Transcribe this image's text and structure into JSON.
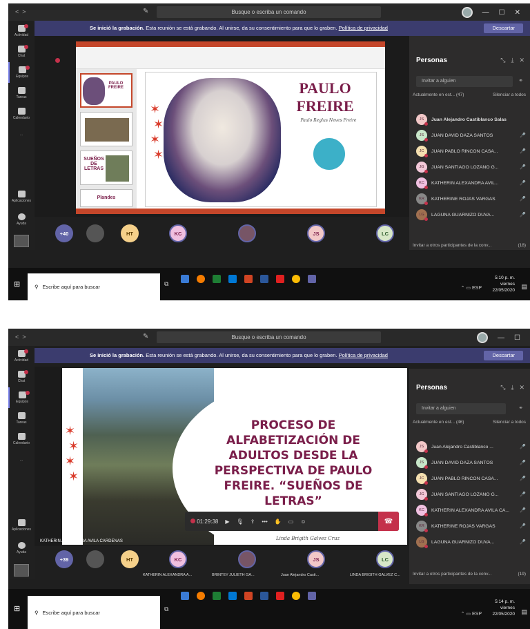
{
  "app": {
    "search_placeholder": "Busque o escriba un comando",
    "nav_back": "<",
    "nav_forward": ">",
    "window_minimize": "—",
    "window_maximize": "☐",
    "window_close": "✕"
  },
  "rail": {
    "items": [
      {
        "label": "Actividad",
        "badge": true
      },
      {
        "label": "Chat",
        "badge": true
      },
      {
        "label": "Equipos",
        "badge": true
      },
      {
        "label": "Tareas",
        "badge": false
      },
      {
        "label": "Calendario",
        "badge": false
      },
      {
        "label": "...",
        "badge": false
      }
    ],
    "apps_label": "Aplicaciones",
    "help_label": "Ayuda"
  },
  "banner": {
    "bold": "Se inició la grabación.",
    "text": " Esta reunión se está grabando. Al unirse, da su consentimiento para que lo graben. ",
    "link": "Política de privacidad",
    "button": "Descartar"
  },
  "people": {
    "title": "Personas",
    "invite_placeholder": "Invitar a alguien",
    "mute_all": "Silenciar a todos",
    "invite_others": "Invitar a otros participantes de la conv..."
  },
  "shot1": {
    "current_label": "Actualmente en est... (47)",
    "invite_count": "(18)",
    "participants": [
      {
        "initials": "JS",
        "name": "Juan Alejandro Castiblanco Salas",
        "color": "#f2c8c8",
        "bold": true
      },
      {
        "initials": "JS",
        "name": "JUAN DAVID DAZA SANTOS",
        "color": "#c8e6c9",
        "bold": false
      },
      {
        "initials": "JC",
        "name": "JUAN PABLO RINCON CASA...",
        "color": "#f5e0b0",
        "bold": false
      },
      {
        "initials": "JG",
        "name": "JUAN SANTIAGO LOZANO G...",
        "color": "#f2c8d8",
        "bold": false
      },
      {
        "initials": "KC",
        "name": "KATHERIN ALEXANDRA AVIL...",
        "color": "#f0c0e0",
        "bold": false
      },
      {
        "initials": "KR",
        "name": "KATHERINE ROJAS VARGAS",
        "color": "#888888",
        "bold": false
      },
      {
        "initials": "LG",
        "name": "LAGUNA GUARNIZO DUVA...",
        "color": "#a07050",
        "bold": false
      }
    ],
    "strip": [
      {
        "label": "+40",
        "color": "#6264a7",
        "text_color": "#fff"
      },
      {
        "label": "",
        "color": "#555",
        "text_color": "#fff"
      },
      {
        "label": "HT",
        "color": "#f5d08a",
        "text_color": "#5a3a00"
      },
      {
        "label": "KC",
        "color": "#f0c0e0",
        "text_color": "#7a1e4a"
      },
      {
        "label": "",
        "color": "#775566",
        "text_color": "#fff"
      },
      {
        "label": "JS",
        "color": "#f2c8c8",
        "text_color": "#7a1e4a"
      },
      {
        "label": "LC",
        "color": "#d8e8c8",
        "text_color": "#2a5a2a"
      }
    ],
    "slide_title_1": "PAULO",
    "slide_title_2": "FREIRE",
    "slide_subtitle": "Paulo Reglus Neves Freire",
    "thumb_1": "PAULO FREIRE",
    "thumb_3": "SUEÑOS DE LETRAS",
    "thumb_4": "Plandes",
    "clock_time": "5:10 p. m.",
    "clock_day": "viernes",
    "clock_date": "22/05/2020"
  },
  "shot2": {
    "current_label": "Actualmente en est... (46)",
    "invite_count": "(19)",
    "participants": [
      {
        "initials": "JS",
        "name": "Juan Alejandro Castiblanco ...",
        "color": "#f2c8c8",
        "bold": false
      },
      {
        "initials": "JS",
        "name": "JUAN DAVID DAZA SANTOS",
        "color": "#c8e6c9",
        "bold": false
      },
      {
        "initials": "JC",
        "name": "JUAN PABLO RINCON CASA...",
        "color": "#f5e0b0",
        "bold": false
      },
      {
        "initials": "JG",
        "name": "JUAN SANTIAGO LOZANO G...",
        "color": "#f2c8d8",
        "bold": false
      },
      {
        "initials": "KC",
        "name": "KATHERIN ALEXANDRA AVILA CA...",
        "color": "#f0c0e0",
        "bold": false
      },
      {
        "initials": "KR",
        "name": "KATHERINE ROJAS VARGAS",
        "color": "#888888",
        "bold": false
      },
      {
        "initials": "LG",
        "name": "LAGUNA GUARNIZO DUVA...",
        "color": "#a07050",
        "bold": false
      }
    ],
    "strip": [
      {
        "label": "+39",
        "color": "#6264a7",
        "text_color": "#fff",
        "name": ""
      },
      {
        "label": "",
        "color": "#555",
        "text_color": "#fff",
        "name": ""
      },
      {
        "label": "HT",
        "color": "#f5d08a",
        "text_color": "#5a3a00",
        "name": ""
      },
      {
        "label": "KC",
        "color": "#f0c0e0",
        "text_color": "#7a1e4a",
        "name": "KATHERIN ALEXANDRA A..."
      },
      {
        "label": "",
        "color": "#775566",
        "text_color": "#fff",
        "name": "BRINTEY JULIETH GA..."
      },
      {
        "label": "JS",
        "color": "#f2c8c8",
        "text_color": "#7a1e4a",
        "name": "Juan Alejandro Casti..."
      },
      {
        "label": "LC",
        "color": "#d8e8c8",
        "text_color": "#2a5a2a",
        "name": "LINDA BRIGITH GALVEZ C..."
      }
    ],
    "presenter": "KATHERIN ALEXANDRA AVILA CARDENAS",
    "slide_title": "PROCESO DE ALFABETIZACIÓN DE ADULTOS DESDE LA PERSPECTIVA DE PAULO FREIRE. “SUEÑOS DE LETRAS”",
    "signature": "Linda Brigith Galvez Cruz",
    "call_time": "01:29:38",
    "clock_time": "5:14 p. m.",
    "clock_day": "viernes",
    "clock_date": "22/05/2020"
  },
  "taskbar": {
    "search": "Escribe aquí para buscar",
    "lang": "ESP"
  },
  "colors": {
    "teams_purple": "#6264a7",
    "banner": "#3b3c6e",
    "slide_accent": "#7a1e4a",
    "hangup": "#c4314b"
  }
}
